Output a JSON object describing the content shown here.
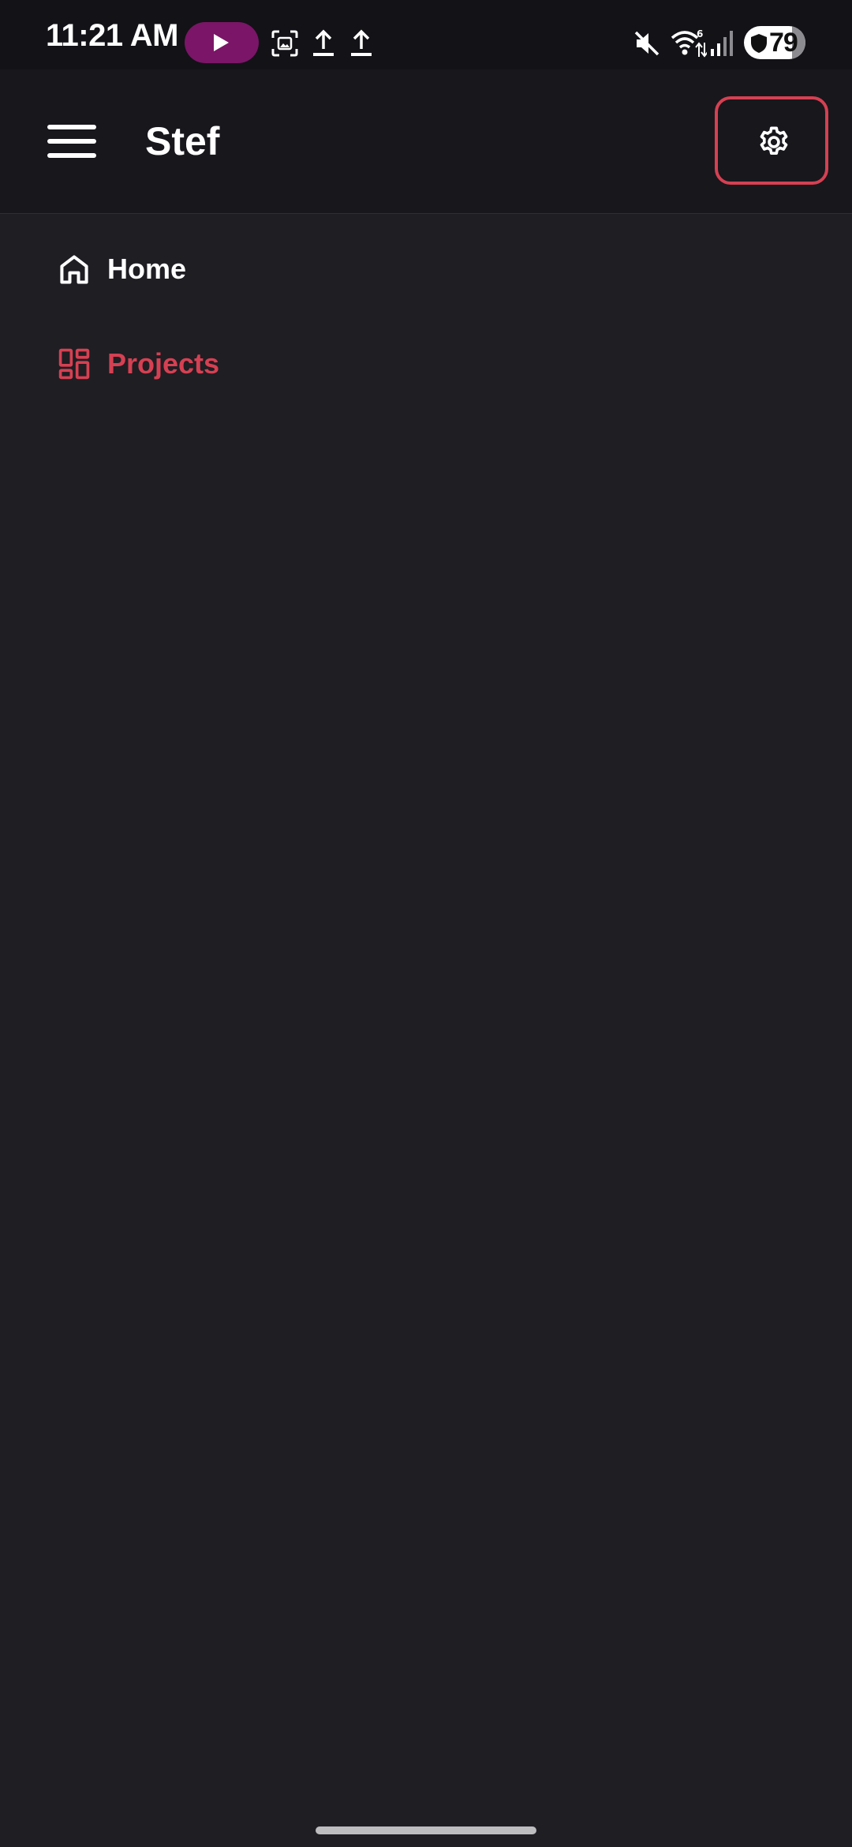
{
  "status_bar": {
    "time": "11:21 AM",
    "battery_level": "79",
    "icons": [
      "play-icon",
      "screenshot-icon",
      "upload-icon",
      "upload-icon",
      "mute-icon",
      "wifi-icon",
      "signal-icon",
      "shield-icon"
    ]
  },
  "app_bar": {
    "title": "Stef",
    "menu_icon": "hamburger-menu-icon",
    "settings_icon": "gear-icon"
  },
  "nav": {
    "items": [
      {
        "label": "Home",
        "icon": "home-icon",
        "active": false
      },
      {
        "label": "Projects",
        "icon": "dashboard-icon",
        "active": true
      }
    ]
  },
  "colors": {
    "background": "#1e1e23",
    "app_bar": "#17171c",
    "status_bar": "#121217",
    "accent": "#d64052",
    "media_pill": "#7b1567",
    "text": "#ffffff"
  }
}
